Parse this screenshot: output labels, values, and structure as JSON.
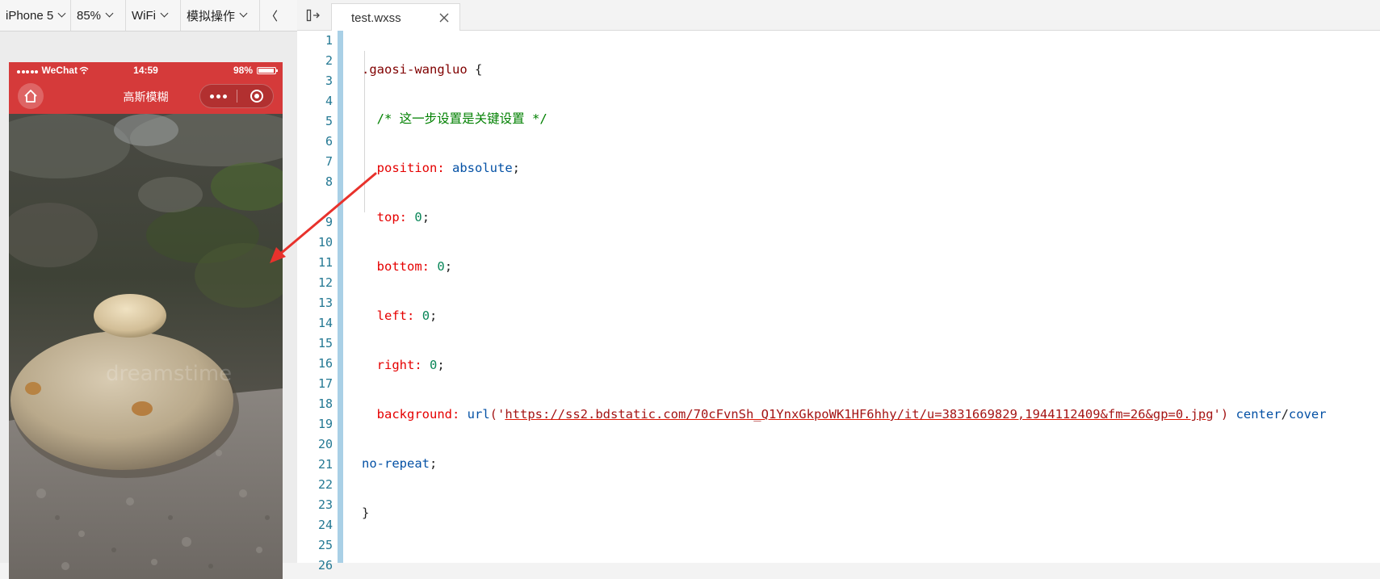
{
  "simulator": {
    "toolbar": {
      "device": "iPhone 5",
      "zoom": "85%",
      "network": "WiFi",
      "operations": "模拟操作",
      "truncated_control": "〈"
    },
    "status_bar": {
      "carrier": "WeChat",
      "time": "14:59",
      "battery": "98%"
    },
    "nav_bar": {
      "title": "高斯模糊"
    },
    "watermark": "dreamstime"
  },
  "editor": {
    "tab": {
      "file_name": "test.wxss"
    },
    "line_numbers": [
      "1",
      "2",
      "3",
      "4",
      "5",
      "6",
      "7",
      "8",
      "9",
      "10",
      "11",
      "12",
      "13",
      "14",
      "15",
      "16",
      "17",
      "18",
      "19",
      "20",
      "21",
      "22",
      "23",
      "24",
      "25",
      "26"
    ],
    "code": {
      "selector": ".gaosi-wangluo",
      "open_brace": " {",
      "comment": "/* 这一步设置是关键设置 */",
      "position_prop": "position:",
      "position_val": "absolute",
      "top_prop": "top:",
      "bottom_prop": "bottom:",
      "left_prop": "left:",
      "right_prop": "right:",
      "zero": "0",
      "semicolon": ";",
      "background_prop": "background:",
      "url_fn": "url",
      "url_open": "('",
      "url_value": "https://ss2.bdstatic.com/70cFvnSh_Q1YnxGkpoWK1HF6hhy/it/u=3831669829,1944112409&fm=26&gp=0.jpg",
      "url_close": "')",
      "center": "center",
      "slash": "/",
      "cover": "cover",
      "no_repeat": "no-repeat",
      "close_brace": "}"
    }
  },
  "colors": {
    "wechat_red": "#d53a3a",
    "annotation_arrow": "#e8322c",
    "gutter_bar": "#a9d0e6"
  }
}
